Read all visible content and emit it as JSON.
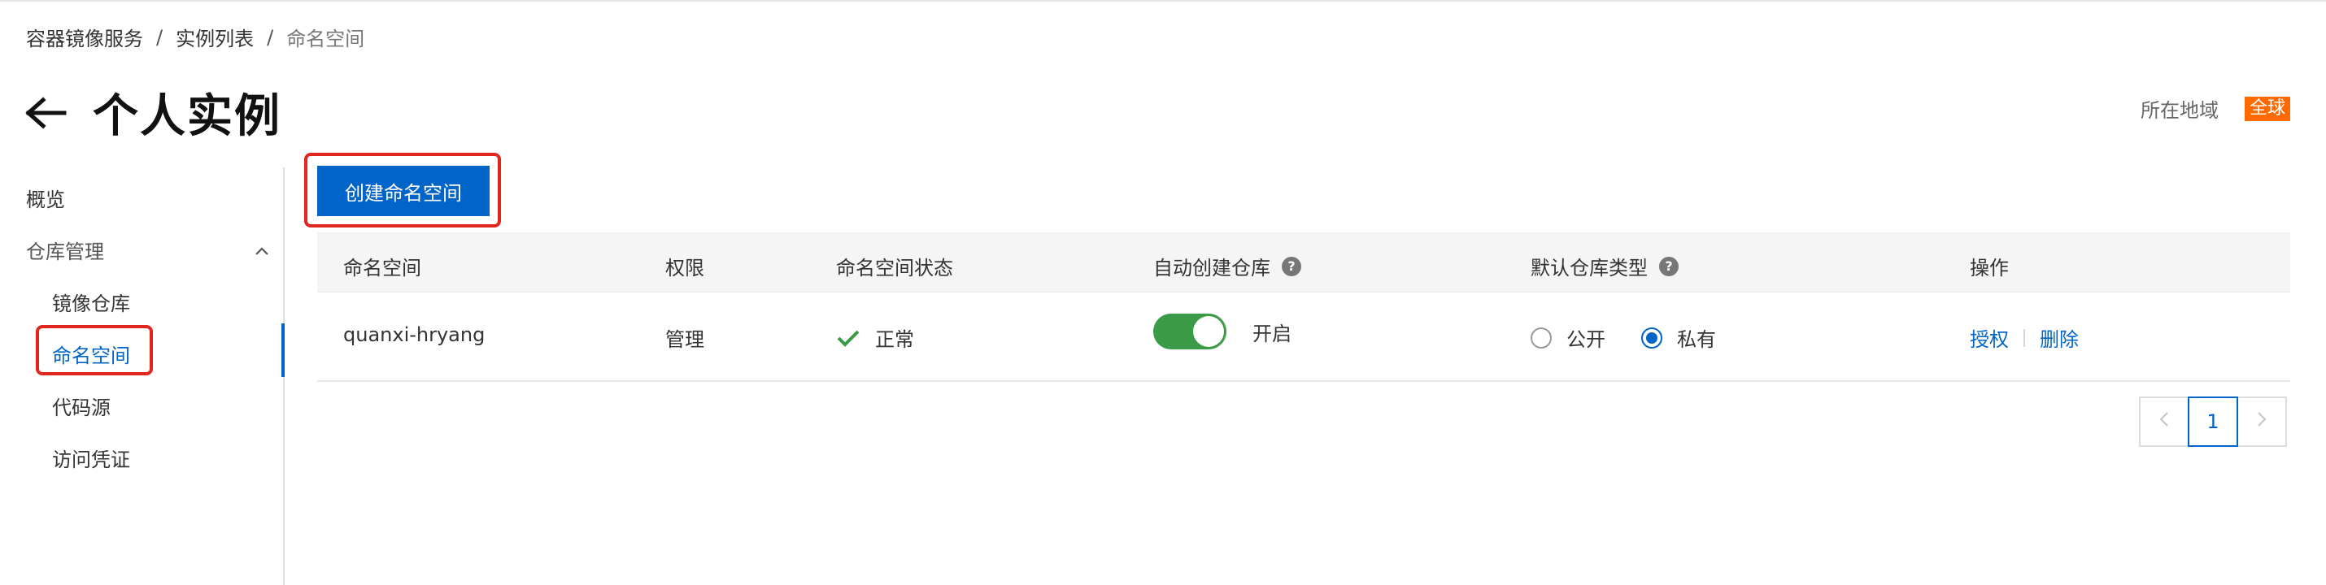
{
  "breadcrumb": {
    "items": [
      "容器镜像服务",
      "实例列表",
      "命名空间"
    ],
    "separator": "/"
  },
  "header": {
    "title": "个人实例",
    "back_icon": "arrow-left-icon",
    "region_label": "所在地域",
    "region_badge": "全球"
  },
  "sidebar": {
    "overview": "概览",
    "repo_group": "仓库管理",
    "items": [
      {
        "label": "镜像仓库",
        "active": false
      },
      {
        "label": "命名空间",
        "active": true
      },
      {
        "label": "代码源",
        "active": false
      },
      {
        "label": "访问凭证",
        "active": false
      }
    ]
  },
  "toolbar": {
    "create_label": "创建命名空间"
  },
  "table": {
    "headers": [
      "命名空间",
      "权限",
      "命名空间状态",
      "自动创建仓库",
      "默认仓库类型",
      "操作"
    ],
    "rows": [
      {
        "namespace": "quanxi-hryang",
        "permission": "管理",
        "status": "正常",
        "auto_create": "开启",
        "auto_create_on": true,
        "repo_type_options": [
          "公开",
          "私有"
        ],
        "repo_type_selected": "私有",
        "actions": [
          "授权",
          "删除"
        ]
      }
    ]
  },
  "pagination": {
    "current_page": "1"
  },
  "colors": {
    "primary": "#0064c8",
    "toggle_on": "#3a9a45",
    "badge": "#ff6a00",
    "highlight": "#e0261f",
    "status_ok": "#3a9a45"
  }
}
